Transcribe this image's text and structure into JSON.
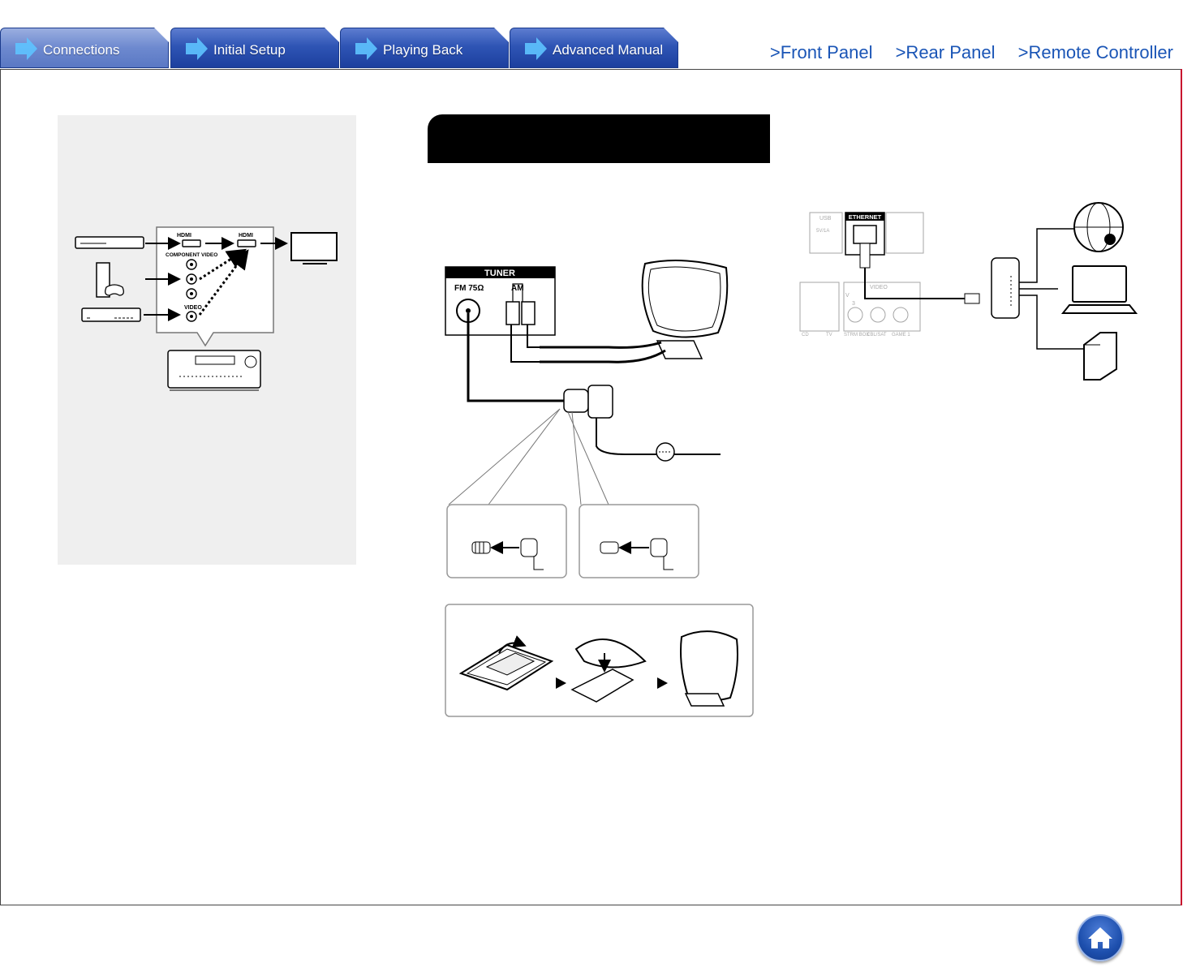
{
  "tabs": [
    {
      "label": "Connections",
      "active": true
    },
    {
      "label": "Initial Setup",
      "active": false
    },
    {
      "label": "Playing Back",
      "active": false
    },
    {
      "label": "Advanced Manual",
      "active": false
    }
  ],
  "nav_links": [
    ">Front Panel",
    ">Rear Panel",
    ">Remote Controller"
  ],
  "video_diagram": {
    "hdmi_in": "HDMI",
    "hdmi_out": "HDMI",
    "component_video": "COMPONENT VIDEO",
    "video": "VIDEO"
  },
  "tuner_diagram": {
    "header": "TUNER",
    "fm": "FM 75Ω",
    "am": "AM"
  },
  "network_diagram": {
    "usb": "USB",
    "usb_rating": "5V/1A",
    "ethernet": "ETHERNET",
    "video_label": "VIDEO",
    "jack_v": "V",
    "jack_num": "3",
    "labels": [
      "CD",
      "TV",
      "STRM BOX",
      "CBL/SAT",
      "GAME 1"
    ]
  },
  "colors": {
    "tab_blue": "#2f55b5",
    "link_blue": "#1a55b6",
    "accent_red": "#c8102e",
    "panel_gray": "#efefef"
  }
}
